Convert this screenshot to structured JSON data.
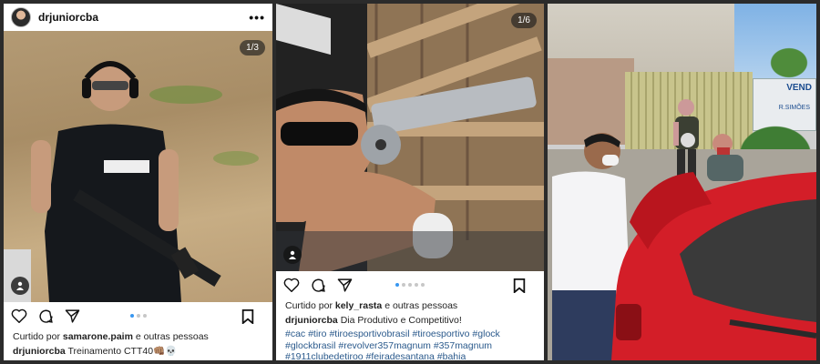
{
  "posts": [
    {
      "username": "drjuniorcba",
      "counter": "1/3",
      "liked_by_prefix": "Curtido por",
      "liked_by_user": "samarone.paim",
      "liked_by_suffix": "e outras pessoas",
      "caption_user": "drjuniorcba",
      "caption_text": "Treinamento CTT40👊🏽💀"
    },
    {
      "counter": "1/6",
      "liked_by_prefix": "Curtido por",
      "liked_by_user": "kely_rasta",
      "liked_by_suffix": "e outras pessoas",
      "caption_user": "drjuniorcba",
      "caption_text": "Dia Produtivo e Competitivo!",
      "hashtags_line1": "#cac #tiro #tiroesportivobrasil #tiroesportivo #glock",
      "hashtags_line2": "#glockbrasil #revolver357magnum #357magnum",
      "hashtags_line3": "#1911clubedetiroo #feiradesantana #bahia"
    }
  ],
  "scene": {
    "sign_title": "VEND",
    "sign_subtitle": "R.SIMÕES"
  },
  "icons": [
    "avatar",
    "more-icon",
    "heart-icon",
    "comment-icon",
    "share-icon",
    "bookmark-icon",
    "user-tag-icon"
  ],
  "colors": {
    "like_dot": "#3897f0",
    "hashtag": "#2b5a8c"
  }
}
